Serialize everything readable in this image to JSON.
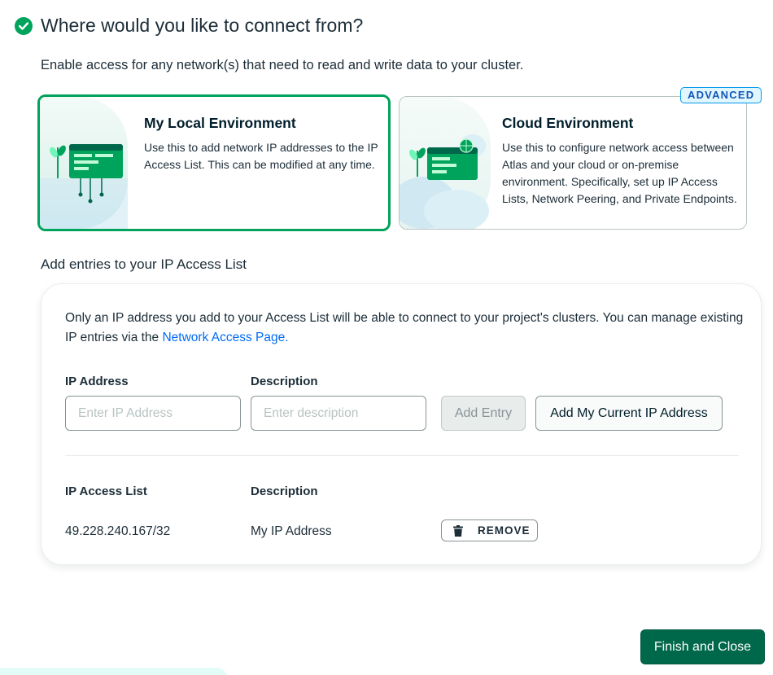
{
  "header": {
    "title": "Where would you like to connect from?",
    "subtitle": "Enable access for any network(s) that need to read and write data to your cluster."
  },
  "environments": {
    "local": {
      "title": "My Local Environment",
      "description": "Use this to add network IP addresses to the IP Access List. This can be modified at any time.",
      "selected": true
    },
    "cloud": {
      "badge": "ADVANCED",
      "title": "Cloud Environment",
      "description": "Use this to configure network access between Atlas and your cloud or on-premise environment. Specifically, set up IP Access Lists, Network Peering, and Private Endpoints.",
      "selected": false
    }
  },
  "access_list": {
    "section_title": "Add entries to your IP Access List",
    "info_text": "Only an IP address you add to your Access List will be able to connect to your project's clusters. You can manage existing IP entries via the ",
    "info_link": "Network Access Page.",
    "ip_label": "IP Address",
    "ip_placeholder": "Enter IP Address",
    "description_label": "Description",
    "description_placeholder": "Enter description",
    "add_entry_label": "Add Entry",
    "add_current_ip_label": "Add My Current IP Address",
    "list_header_ip": "IP Access List",
    "list_header_description": "Description",
    "entries": [
      {
        "ip": "49.228.240.167/32",
        "description": "My IP Address",
        "remove_label": "REMOVE"
      }
    ]
  },
  "footer": {
    "finish_label": "Finish and Close"
  },
  "colors": {
    "primary_green": "#00a35c",
    "dark_green": "#00684a",
    "link_blue": "#016bf8",
    "badge_blue": "#1254b7"
  },
  "icons": [
    "check-circle-icon",
    "local-environment-illustration",
    "cloud-environment-illustration",
    "trash-icon"
  ]
}
